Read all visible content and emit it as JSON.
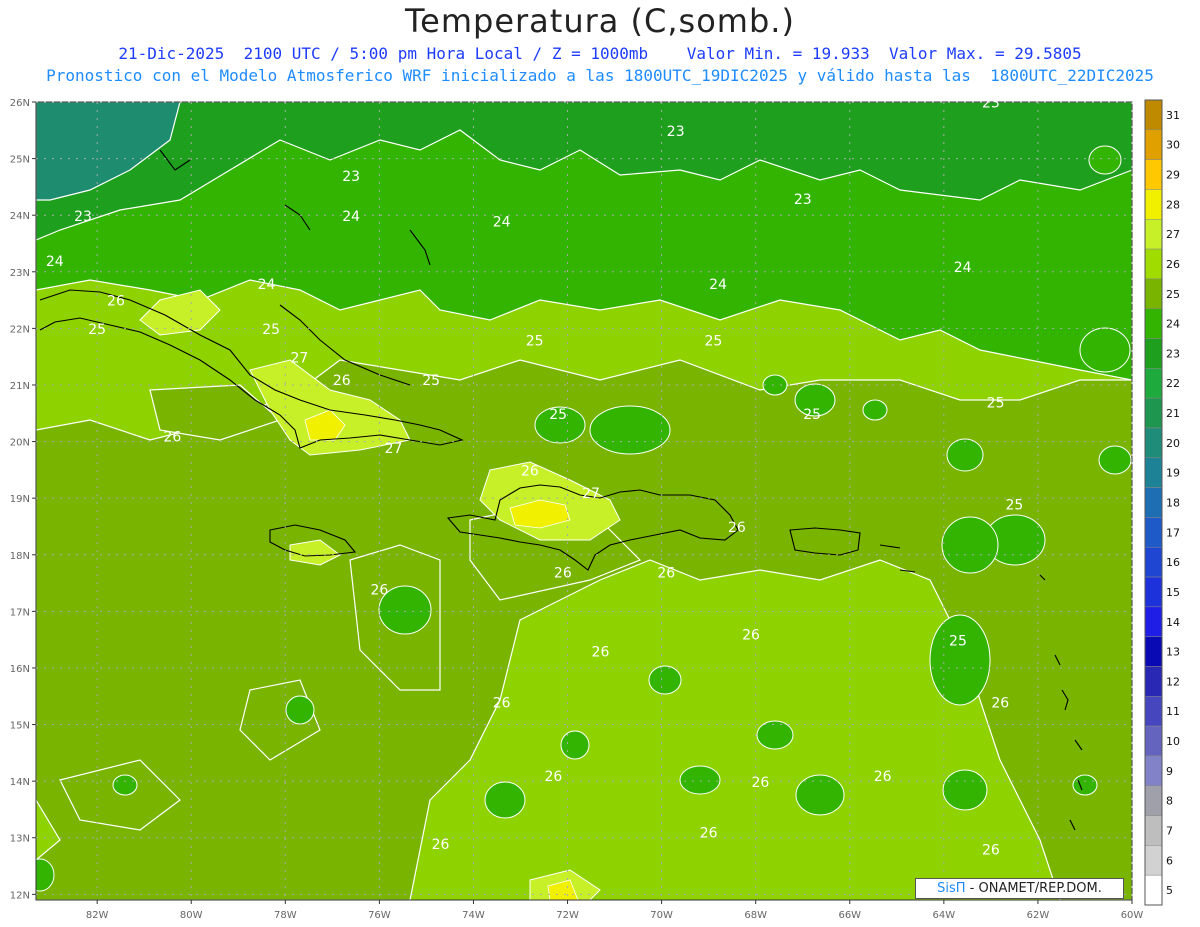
{
  "title": "Temperatura (C,somb.)",
  "subtitle_date": "21-Dic-2025  2100 UTC / 5:00 pm Hora Local / Z = 1000mb",
  "subtitle_minmax": "Valor Min. = 19.933  Valor Max. = 29.5805",
  "subtitle_model": "Pronostico con el Modelo Atmosferico WRF inicializado a las 1800UTC_19DIC2025 y válido hasta las  1800UTC_22DIC2025",
  "credit": {
    "brand": "SisΠ",
    "org": " - ONAMET/REP.DOM."
  },
  "map": {
    "lat_labels": [
      "26N",
      "25N",
      "24N",
      "23N",
      "22N",
      "21N",
      "20N",
      "19N",
      "18N",
      "17N",
      "16N",
      "15N",
      "14N",
      "13N",
      "12N"
    ],
    "lon_labels": [
      "82W",
      "80W",
      "78W",
      "76W",
      "74W",
      "72W",
      "70W",
      "68W",
      "66W",
      "64W",
      "62W",
      "60W"
    ],
    "contour_labels": [
      {
        "text": "23",
        "lon": -76.6,
        "lat": 24.6
      },
      {
        "text": "23",
        "lon": -69.7,
        "lat": 25.4
      },
      {
        "text": "23",
        "lon": -67.0,
        "lat": 24.2
      },
      {
        "text": "23",
        "lon": -63.0,
        "lat": 25.9
      },
      {
        "text": "23",
        "lon": -82.3,
        "lat": 23.9
      },
      {
        "text": "24",
        "lon": -82.9,
        "lat": 23.1
      },
      {
        "text": "24",
        "lon": -78.4,
        "lat": 22.7
      },
      {
        "text": "24",
        "lon": -76.6,
        "lat": 23.9
      },
      {
        "text": "24",
        "lon": -73.4,
        "lat": 23.8
      },
      {
        "text": "24",
        "lon": -68.8,
        "lat": 22.7
      },
      {
        "text": "24",
        "lon": -63.6,
        "lat": 23.0
      },
      {
        "text": "25",
        "lon": -82.0,
        "lat": 21.9
      },
      {
        "text": "25",
        "lon": -78.3,
        "lat": 21.9
      },
      {
        "text": "25",
        "lon": -74.9,
        "lat": 21.0
      },
      {
        "text": "25",
        "lon": -72.7,
        "lat": 21.7
      },
      {
        "text": "25",
        "lon": -68.9,
        "lat": 21.7
      },
      {
        "text": "25",
        "lon": -72.2,
        "lat": 20.4
      },
      {
        "text": "25",
        "lon": -66.8,
        "lat": 20.4
      },
      {
        "text": "25",
        "lon": -62.9,
        "lat": 20.6
      },
      {
        "text": "25",
        "lon": -62.5,
        "lat": 18.8
      },
      {
        "text": "25",
        "lon": -63.7,
        "lat": 16.4
      },
      {
        "text": "26",
        "lon": -81.6,
        "lat": 22.4
      },
      {
        "text": "26",
        "lon": -76.8,
        "lat": 21.0
      },
      {
        "text": "26",
        "lon": -80.4,
        "lat": 20.0
      },
      {
        "text": "26",
        "lon": -72.8,
        "lat": 19.4
      },
      {
        "text": "26",
        "lon": -68.4,
        "lat": 18.4
      },
      {
        "text": "26",
        "lon": -76.0,
        "lat": 17.3
      },
      {
        "text": "26",
        "lon": -72.1,
        "lat": 17.6
      },
      {
        "text": "26",
        "lon": -69.9,
        "lat": 17.6
      },
      {
        "text": "26",
        "lon": -68.1,
        "lat": 16.5
      },
      {
        "text": "26",
        "lon": -71.3,
        "lat": 16.2
      },
      {
        "text": "26",
        "lon": -73.4,
        "lat": 15.3
      },
      {
        "text": "26",
        "lon": -72.3,
        "lat": 14.0
      },
      {
        "text": "26",
        "lon": -67.9,
        "lat": 13.9
      },
      {
        "text": "26",
        "lon": -65.3,
        "lat": 14.0
      },
      {
        "text": "26",
        "lon": -62.8,
        "lat": 15.3
      },
      {
        "text": "26",
        "lon": -69.0,
        "lat": 13.0
      },
      {
        "text": "26",
        "lon": -74.7,
        "lat": 12.8
      },
      {
        "text": "26",
        "lon": -63.0,
        "lat": 12.7
      },
      {
        "text": "27",
        "lon": -77.7,
        "lat": 21.4
      },
      {
        "text": "27",
        "lon": -75.7,
        "lat": 19.8
      },
      {
        "text": "27",
        "lon": -71.5,
        "lat": 19.0
      }
    ]
  },
  "colorbar": {
    "levels": [
      "31",
      "30",
      "29",
      "28",
      "27",
      "26",
      "25",
      "24",
      "23",
      "22",
      "21",
      "20",
      "19",
      "18",
      "17",
      "16",
      "15",
      "14",
      "13",
      "12",
      "11",
      "10",
      "9",
      "8",
      "7",
      "6",
      "5"
    ],
    "colors": [
      "#c08a00",
      "#e0a000",
      "#ffc800",
      "#f0f000",
      "#c8f028",
      "#a0dc00",
      "#78b400",
      "#32b400",
      "#1ea01e",
      "#1eaa3c",
      "#1e9650",
      "#1e8c78",
      "#1e8296",
      "#1e6eb4",
      "#1e5ac8",
      "#1e46d2",
      "#1e32dc",
      "#1e1ee6",
      "#0a0ab4",
      "#2828b4",
      "#4646be",
      "#6464be",
      "#8282c8",
      "#a0a0aa",
      "#bebebe",
      "#d2d2d2",
      "#ffffff"
    ]
  }
}
